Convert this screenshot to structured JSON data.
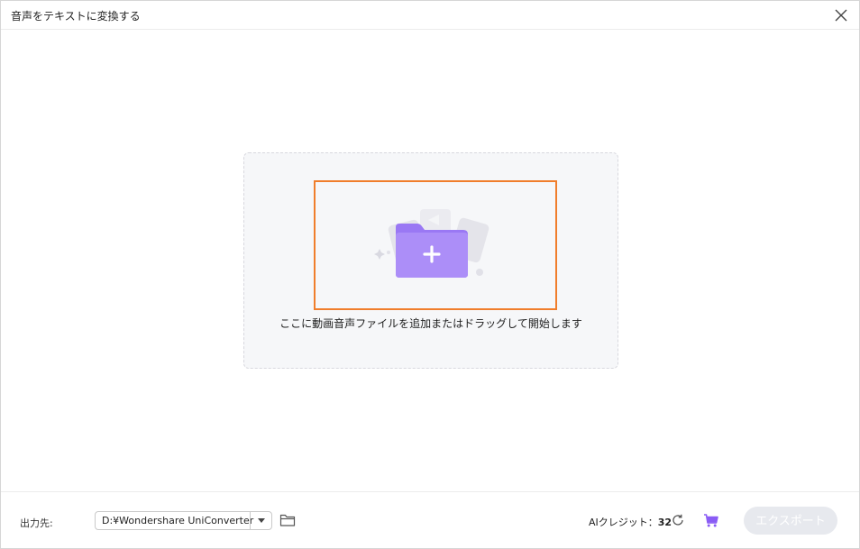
{
  "window": {
    "title": "音声をテキストに変換する"
  },
  "icons": {
    "close": "close-icon",
    "upload": "add-folder-icon",
    "dropdown": "chevron-down-icon",
    "folder": "folder-icon",
    "refresh": "refresh-icon",
    "cart": "cart-icon"
  },
  "dropzone": {
    "instruction": "ここに動画音声ファイルを追加またはドラッグして開始します"
  },
  "footer": {
    "output_label": "出力先:",
    "output_path": "D:¥Wondershare UniConverter",
    "credits_label": "AIクレジット：",
    "credits_value": "32",
    "export_label": "エクスポート"
  },
  "colors": {
    "highlight_border": "#f07e2c",
    "folder_purple": "#a07cf6",
    "cart_purple": "#8a5cf5",
    "export_disabled_bg": "#e7e9ee"
  }
}
